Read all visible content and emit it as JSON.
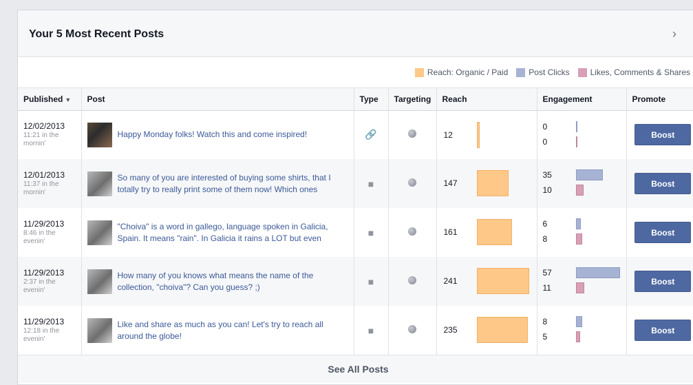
{
  "panel": {
    "title": "Your 5 Most Recent Posts",
    "next_icon": "chevron-right-icon"
  },
  "legend": [
    {
      "label": "Reach: Organic / Paid",
      "color": "#fdc888"
    },
    {
      "label": "Post Clicks",
      "color": "#a7b3d3"
    },
    {
      "label": "Likes, Comments & Shares",
      "color": "#d7a0b6"
    }
  ],
  "columns": {
    "published": "Published",
    "post": "Post",
    "type": "Type",
    "targeting": "Targeting",
    "reach": "Reach",
    "engagement": "Engagement",
    "promote": "Promote"
  },
  "rows": [
    {
      "date": "12/02/2013",
      "time": "11:21 in the mornin'",
      "text": "Happy Monday folks! Watch this and come inspired!",
      "type": "link-icon",
      "reach": 12,
      "clicks": 0,
      "likes": 0,
      "boost": "Boost"
    },
    {
      "date": "12/01/2013",
      "time": "11:37 in the mornin'",
      "text": "So many of you are interested of buying some shirts, that I totally try to really print some of them now! Which ones",
      "type": "status-icon",
      "reach": 147,
      "clicks": 35,
      "likes": 10,
      "boost": "Boost"
    },
    {
      "date": "11/29/2013",
      "time": "8:46 in the evenin'",
      "text": "\"Choiva\" is a word in gallego, language spoken in Galicia, Spain. It means \"rain\". In Galicia it rains a LOT but even",
      "type": "status-icon",
      "reach": 161,
      "clicks": 6,
      "likes": 8,
      "boost": "Boost"
    },
    {
      "date": "11/29/2013",
      "time": "2:37 in the evenin'",
      "text": "How many of you knows what means the name of the collection, \"choiva\"? Can you guess? ;)",
      "type": "status-icon",
      "reach": 241,
      "clicks": 57,
      "likes": 11,
      "boost": "Boost"
    },
    {
      "date": "11/29/2013",
      "time": "12:18 in the evenin'",
      "text": "Like and share as much as you can! Let's try to reach all around the globe!",
      "type": "status-icon",
      "reach": 235,
      "clicks": 8,
      "likes": 5,
      "boost": "Boost"
    }
  ],
  "footer": {
    "label": "See All Posts"
  }
}
